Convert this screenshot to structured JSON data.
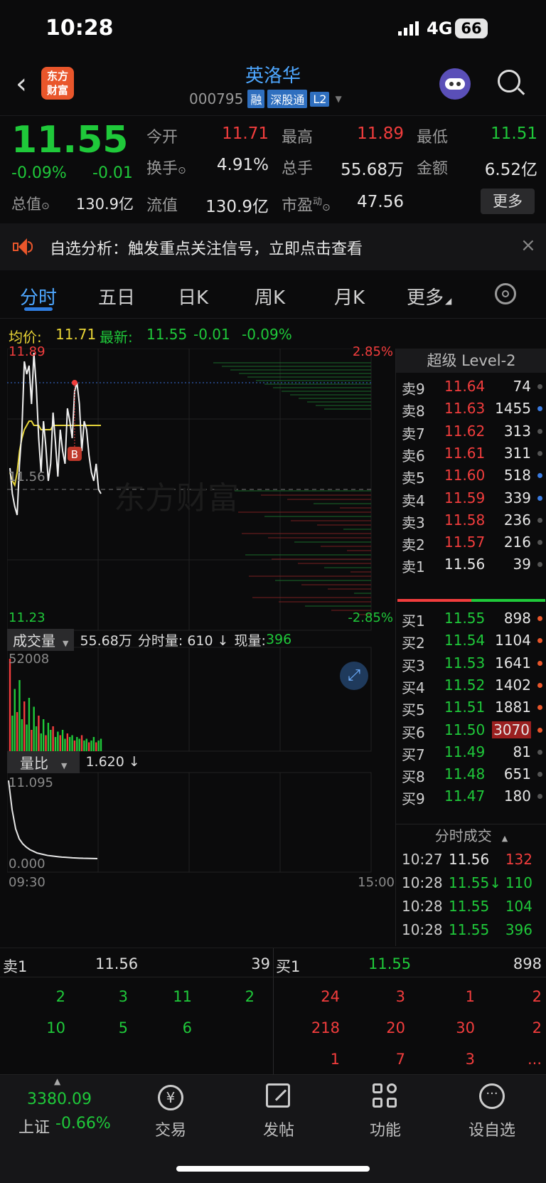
{
  "status": {
    "time": "10:28",
    "network": "4G",
    "battery": "66"
  },
  "header": {
    "logo_line1": "东方",
    "logo_line2": "财富",
    "title": "英洛华",
    "code": "000795",
    "badges": [
      "融",
      "深股通",
      "L2"
    ]
  },
  "quote": {
    "price": "11.55",
    "change_pct": "-0.09%",
    "change": "-0.01",
    "fields": [
      {
        "label": "今开",
        "value": "11.71",
        "color": "red"
      },
      {
        "label": "最高",
        "value": "11.89",
        "color": "red"
      },
      {
        "label": "最低",
        "value": "11.51",
        "color": "green"
      },
      {
        "label": "换手",
        "value": "4.91%",
        "color": "white"
      },
      {
        "label": "总手",
        "value": "55.68万",
        "color": "white"
      },
      {
        "label": "金额",
        "value": "6.52亿",
        "color": "white"
      },
      {
        "label": "总值",
        "value": "130.9亿",
        "color": "white"
      },
      {
        "label": "流值",
        "value": "130.9亿",
        "color": "white"
      },
      {
        "label": "市盈",
        "sup": "动",
        "value": "47.56",
        "color": "white"
      }
    ],
    "more": "更多"
  },
  "notice": {
    "text": "自选分析：触发重点关注信号，立即点击查看"
  },
  "tabs": [
    "分时",
    "五日",
    "日K",
    "周K",
    "月K",
    "更多"
  ],
  "chart_info": {
    "avg_label": "均价:",
    "avg": "11.71",
    "latest_label": "最新:",
    "latest": "11.55",
    "chg": "-0.01",
    "pct": "-0.09%"
  },
  "chart_data": {
    "type": "line",
    "price_axis": {
      "max": "11.89",
      "mid": "11.56",
      "min": "11.23",
      "max_pct": "2.85%",
      "min_pct": "-2.85%"
    },
    "ylim": [
      11.23,
      11.89
    ],
    "price": [
      11.61,
      11.55,
      11.52,
      11.5,
      11.62,
      11.7,
      11.86,
      11.83,
      11.85,
      11.76,
      11.88,
      11.8,
      11.68,
      11.6,
      11.72,
      11.66,
      11.58,
      11.62,
      11.74,
      11.67,
      11.59,
      11.7,
      11.65,
      11.62,
      11.75,
      11.72,
      11.68,
      11.79,
      11.81,
      11.76,
      11.65,
      11.72,
      11.7,
      11.64,
      11.6,
      11.58,
      11.62,
      11.56,
      11.55
    ],
    "avg": [
      11.6,
      11.58,
      11.57,
      11.6,
      11.65,
      11.68,
      11.7,
      11.71,
      11.72,
      11.72,
      11.71,
      11.71,
      11.71,
      11.7,
      11.7,
      11.7,
      11.7,
      11.7,
      11.71,
      11.71,
      11.71,
      11.71,
      11.71,
      11.71,
      11.71,
      11.71,
      11.71,
      11.71,
      11.71,
      11.71,
      11.71,
      11.71,
      11.71,
      11.71,
      11.71,
      11.71,
      11.71,
      11.71,
      11.71
    ],
    "marker": "B",
    "volume_label": "成交量",
    "volume_total": "55.68万",
    "minute_vol": "分时量: 610 ↓",
    "current_vol_label": "现量:",
    "current_vol": "396",
    "vol_max": "52008",
    "volumes": [
      52,
      20,
      35,
      22,
      40,
      18,
      28,
      15,
      30,
      12,
      25,
      14,
      20,
      10,
      18,
      9,
      16,
      12,
      14,
      8,
      11,
      9,
      12,
      7,
      10,
      8,
      9,
      6,
      8,
      7,
      9,
      6,
      7,
      5,
      6,
      8,
      5,
      6,
      7
    ],
    "ratio_label": "量比",
    "ratio_value": "1.620 ↓",
    "ratio_max": "11.095",
    "ratio_min": "0.000",
    "ratio": [
      11.0,
      7.5,
      5.2,
      4.0,
      3.4,
      3.0,
      2.7,
      2.5,
      2.3,
      2.2,
      2.1,
      2.0,
      1.95,
      1.9,
      1.85,
      1.8,
      1.78,
      1.75,
      1.72,
      1.7,
      1.68,
      1.66,
      1.65,
      1.64,
      1.63,
      1.62
    ],
    "time_start": "09:30",
    "time_end": "15:00"
  },
  "book": {
    "title": "超级 Level-2",
    "asks": [
      {
        "l": "卖9",
        "p": "11.64",
        "v": "74"
      },
      {
        "l": "卖8",
        "p": "11.63",
        "v": "1455"
      },
      {
        "l": "卖7",
        "p": "11.62",
        "v": "313"
      },
      {
        "l": "卖6",
        "p": "11.61",
        "v": "311"
      },
      {
        "l": "卖5",
        "p": "11.60",
        "v": "518"
      },
      {
        "l": "卖4",
        "p": "11.59",
        "v": "339"
      },
      {
        "l": "卖3",
        "p": "11.58",
        "v": "236"
      },
      {
        "l": "卖2",
        "p": "11.57",
        "v": "216"
      },
      {
        "l": "卖1",
        "p": "11.56",
        "v": "39"
      }
    ],
    "bids": [
      {
        "l": "买1",
        "p": "11.55",
        "v": "898"
      },
      {
        "l": "买2",
        "p": "11.54",
        "v": "1104"
      },
      {
        "l": "买3",
        "p": "11.53",
        "v": "1641"
      },
      {
        "l": "买4",
        "p": "11.52",
        "v": "1402"
      },
      {
        "l": "买5",
        "p": "11.51",
        "v": "1881"
      },
      {
        "l": "买6",
        "p": "11.50",
        "v": "3070"
      },
      {
        "l": "买7",
        "p": "11.49",
        "v": "81"
      },
      {
        "l": "买8",
        "p": "11.48",
        "v": "651"
      },
      {
        "l": "买9",
        "p": "11.47",
        "v": "180"
      }
    ],
    "trades_title": "分时成交",
    "trades": [
      {
        "t": "10:27",
        "p": "11.56",
        "v": "132"
      },
      {
        "t": "10:28",
        "p": "11.55↓",
        "v": "110"
      },
      {
        "t": "10:28",
        "p": "11.55",
        "v": "104"
      },
      {
        "t": "10:28",
        "p": "11.55",
        "v": "396"
      }
    ]
  },
  "ticks": {
    "sell_label": "卖1",
    "sell_price": "11.56",
    "sell_vol": "39",
    "buy_label": "买1",
    "buy_price": "11.55",
    "buy_vol": "898",
    "sell_rows": [
      [
        "2",
        "3",
        "11",
        "2"
      ],
      [
        "10",
        "5",
        "6",
        ""
      ]
    ],
    "buy_rows": [
      [
        "24",
        "3",
        "1",
        "2"
      ],
      [
        "218",
        "20",
        "30",
        "2"
      ],
      [
        "1",
        "7",
        "3",
        "..."
      ]
    ]
  },
  "bottom": {
    "index_value": "3380.09",
    "index_name": "上证",
    "index_pct": "-0.66%",
    "items": [
      "交易",
      "发帖",
      "功能",
      "设自选"
    ]
  }
}
